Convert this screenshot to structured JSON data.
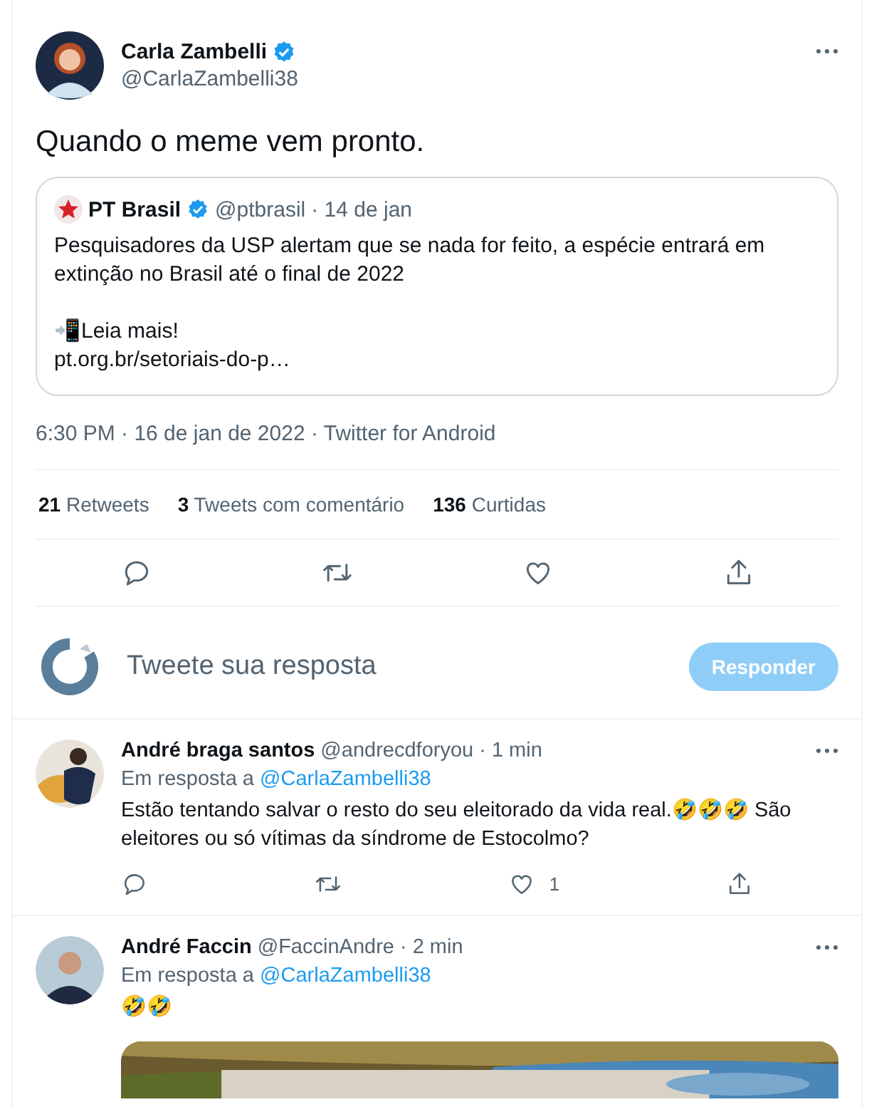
{
  "tweet": {
    "author": {
      "name": "Carla Zambelli",
      "handle": "@CarlaZambelli38",
      "verified": true
    },
    "text": "Quando o meme vem pronto.",
    "quote": {
      "name": "PT Brasil",
      "verified": true,
      "handle": "@ptbrasil",
      "date": "· 14 de jan",
      "text": "Pesquisadores da USP alertam que se nada for feito, a espécie entrará em extinção no Brasil até o final de 2022",
      "lines": [
        "📲Leia mais!",
        "pt.org.br/setoriais-do-p…"
      ]
    },
    "meta": "6:30 PM · 16 de jan de 2022 · Twitter for Android",
    "stats": [
      {
        "count": "21",
        "label": "Retweets"
      },
      {
        "count": "3",
        "label": "Tweets com comentário"
      },
      {
        "count": "136",
        "label": "Curtidas"
      }
    ],
    "actions": [
      {
        "kind": "reply"
      },
      {
        "kind": "retweet"
      },
      {
        "kind": "like"
      },
      {
        "kind": "share"
      }
    ]
  },
  "composer": {
    "placeholder": "Tweete sua resposta",
    "button": "Responder",
    "disabled": true
  },
  "replies": [
    {
      "name": "André braga santos",
      "handle": "@andrecdforyou",
      "time": "· 1 min",
      "reply_prefix": "Em resposta a",
      "reply_to": "@CarlaZambelli38",
      "text": "Estão tentando salvar o resto do seu eleitorado da vida real.🤣🤣🤣 São eleitores ou só vítimas da síndrome de Estocolmo?",
      "actions": [
        {
          "kind": "reply"
        },
        {
          "kind": "retweet"
        },
        {
          "kind": "like",
          "count": "1"
        },
        {
          "kind": "share"
        }
      ]
    },
    {
      "name": "André Faccin",
      "handle": "@FaccinAndre",
      "time": "· 2 min",
      "reply_prefix": "Em resposta a",
      "reply_to": "@CarlaZambelli38",
      "text": "🤣🤣"
    }
  ]
}
